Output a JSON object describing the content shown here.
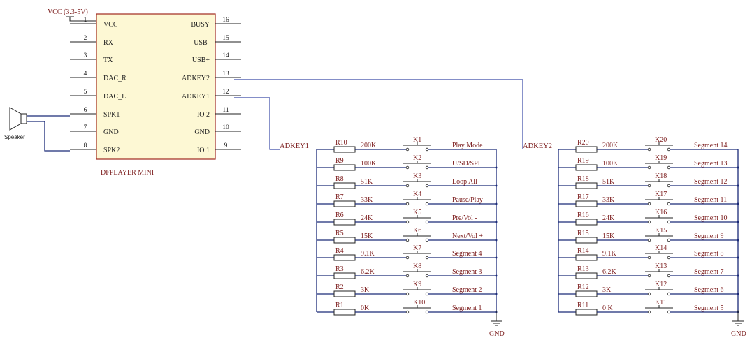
{
  "ic": {
    "name": "DFPLAYER MINI",
    "left_pins": [
      {
        "num": "1",
        "name": "VCC"
      },
      {
        "num": "2",
        "name": "RX"
      },
      {
        "num": "3",
        "name": "TX"
      },
      {
        "num": "4",
        "name": "DAC_R"
      },
      {
        "num": "5",
        "name": "DAC_L"
      },
      {
        "num": "6",
        "name": "SPK1"
      },
      {
        "num": "7",
        "name": "GND"
      },
      {
        "num": "8",
        "name": "SPK2"
      }
    ],
    "right_pins": [
      {
        "num": "16",
        "name": "BUSY"
      },
      {
        "num": "15",
        "name": "USB-"
      },
      {
        "num": "14",
        "name": "USB+"
      },
      {
        "num": "13",
        "name": "ADKEY2"
      },
      {
        "num": "12",
        "name": "ADKEY1"
      },
      {
        "num": "11",
        "name": "IO 2"
      },
      {
        "num": "10",
        "name": "GND"
      },
      {
        "num": "9",
        "name": "IO 1"
      }
    ]
  },
  "vcc_label": "VCC (3.3-5V)",
  "speaker_label": "Speaker",
  "net1": "ADKEY1",
  "net2": "ADKEY2",
  "gnd_label": "GND",
  "bank1": [
    {
      "r": "R10",
      "v": "200K",
      "k": "K1",
      "f": "Play Mode"
    },
    {
      "r": "R9",
      "v": "100K",
      "k": "K2",
      "f": "U/SD/SPI"
    },
    {
      "r": "R8",
      "v": "51K",
      "k": "K3",
      "f": "Loop All"
    },
    {
      "r": "R7",
      "v": "33K",
      "k": "K4",
      "f": "Pause/Play"
    },
    {
      "r": "R6",
      "v": "24K",
      "k": "K5",
      "f": "Pre/Vol -"
    },
    {
      "r": "R5",
      "v": "15K",
      "k": "K6",
      "f": "Next/Vol +"
    },
    {
      "r": "R4",
      "v": "9.1K",
      "k": "K7",
      "f": "Segment 4"
    },
    {
      "r": "R3",
      "v": "6.2K",
      "k": "K8",
      "f": "Segment 3"
    },
    {
      "r": "R2",
      "v": "3K",
      "k": "K9",
      "f": "Segment 2"
    },
    {
      "r": "R1",
      "v": "0K",
      "k": "K10",
      "f": "Segment 1"
    }
  ],
  "bank2": [
    {
      "r": "R20",
      "v": "200K",
      "k": "K20",
      "f": "Segment 14"
    },
    {
      "r": "R19",
      "v": "100K",
      "k": "K19",
      "f": "Segment 13"
    },
    {
      "r": "R18",
      "v": "51K",
      "k": "K18",
      "f": "Segment 12"
    },
    {
      "r": "R17",
      "v": "33K",
      "k": "K17",
      "f": "Segment 11"
    },
    {
      "r": "R16",
      "v": "24K",
      "k": "K16",
      "f": "Segment 10"
    },
    {
      "r": "R15",
      "v": "15K",
      "k": "K15",
      "f": "Segment 9"
    },
    {
      "r": "R14",
      "v": "9.1K",
      "k": "K14",
      "f": "Segment 8"
    },
    {
      "r": "R13",
      "v": "6.2K",
      "k": "K13",
      "f": "Segment 7"
    },
    {
      "r": "R12",
      "v": "3K",
      "k": "K12",
      "f": "Segment 6"
    },
    {
      "r": "R11",
      "v": "0 K",
      "k": "K11",
      "f": "Segment 5"
    }
  ]
}
